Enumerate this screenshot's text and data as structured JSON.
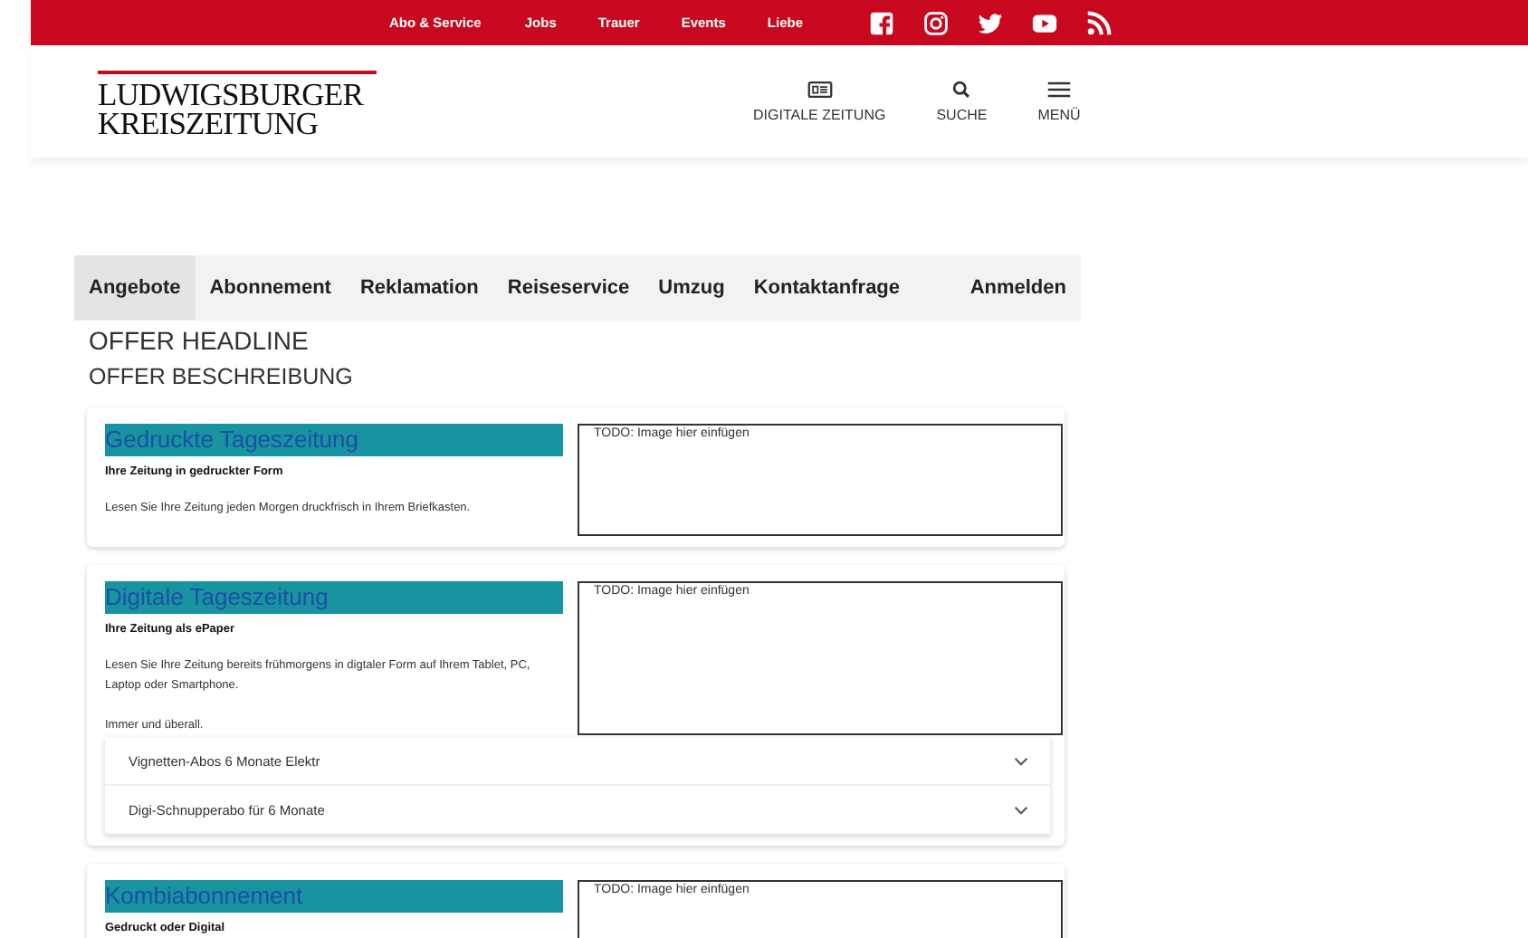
{
  "top_bar": {
    "links": [
      "Abo & Service",
      "Jobs",
      "Trauer",
      "Events",
      "Liebe"
    ],
    "social": [
      {
        "kind": "facebook"
      },
      {
        "kind": "instagram"
      },
      {
        "kind": "twitter"
      },
      {
        "kind": "youtube"
      },
      {
        "kind": "rss"
      }
    ]
  },
  "header": {
    "logo": [
      "LUDWIGSBURGER",
      "KREISZEITUNG"
    ],
    "actions": [
      {
        "kind": "newspaper",
        "label": "DIGITALE ZEITUNG"
      },
      {
        "kind": "search",
        "label": "SUCHE"
      },
      {
        "kind": "menu",
        "label": "MENÜ"
      }
    ]
  },
  "nav": {
    "tabs": [
      {
        "label": "Angebote",
        "selected": true
      },
      {
        "label": "Abonnement",
        "selected": false
      },
      {
        "label": "Reklamation",
        "selected": false
      },
      {
        "label": "Reiseservice",
        "selected": false
      },
      {
        "label": "Umzug",
        "selected": false
      },
      {
        "label": "Kontaktanfrage",
        "selected": false
      }
    ],
    "login": "Anmelden"
  },
  "headline": "OFFER HEADLINE",
  "description": "OFFER BESCHREIBUNG",
  "offers": [
    {
      "title": "Gedruckte Tageszeitung",
      "subtitle": "Ihre Zeitung in gedruckter Form",
      "paragraphs": [
        "Lesen Sie Ihre Zeitung jeden Morgen druckfrisch in Ihrem Briefkasten."
      ],
      "image_note": "TODO: Image hier einfügen"
    },
    {
      "title": "Digitale Tageszeitung",
      "subtitle": "Ihre Zeitung als ePaper",
      "paragraphs": [
        "Lesen Sie Ihre Zeitung bereits frühmorgens in digtaler Form auf Ihrem Tablet, PC, Laptop oder Smartphone.",
        "Immer und überall."
      ],
      "image_note": "TODO: Image hier einfügen",
      "options": [
        {
          "label": "Vignetten-Abos 6 Monate Elektr",
          "expanded": false
        },
        {
          "label": "Digi-Schnupperabo für 6 Monate",
          "expanded": false
        }
      ]
    },
    {
      "title": "Kombiabonnement",
      "subtitle": "Gedruckt oder Digital",
      "image_note": "TODO: Image hier einfügen"
    }
  ]
}
